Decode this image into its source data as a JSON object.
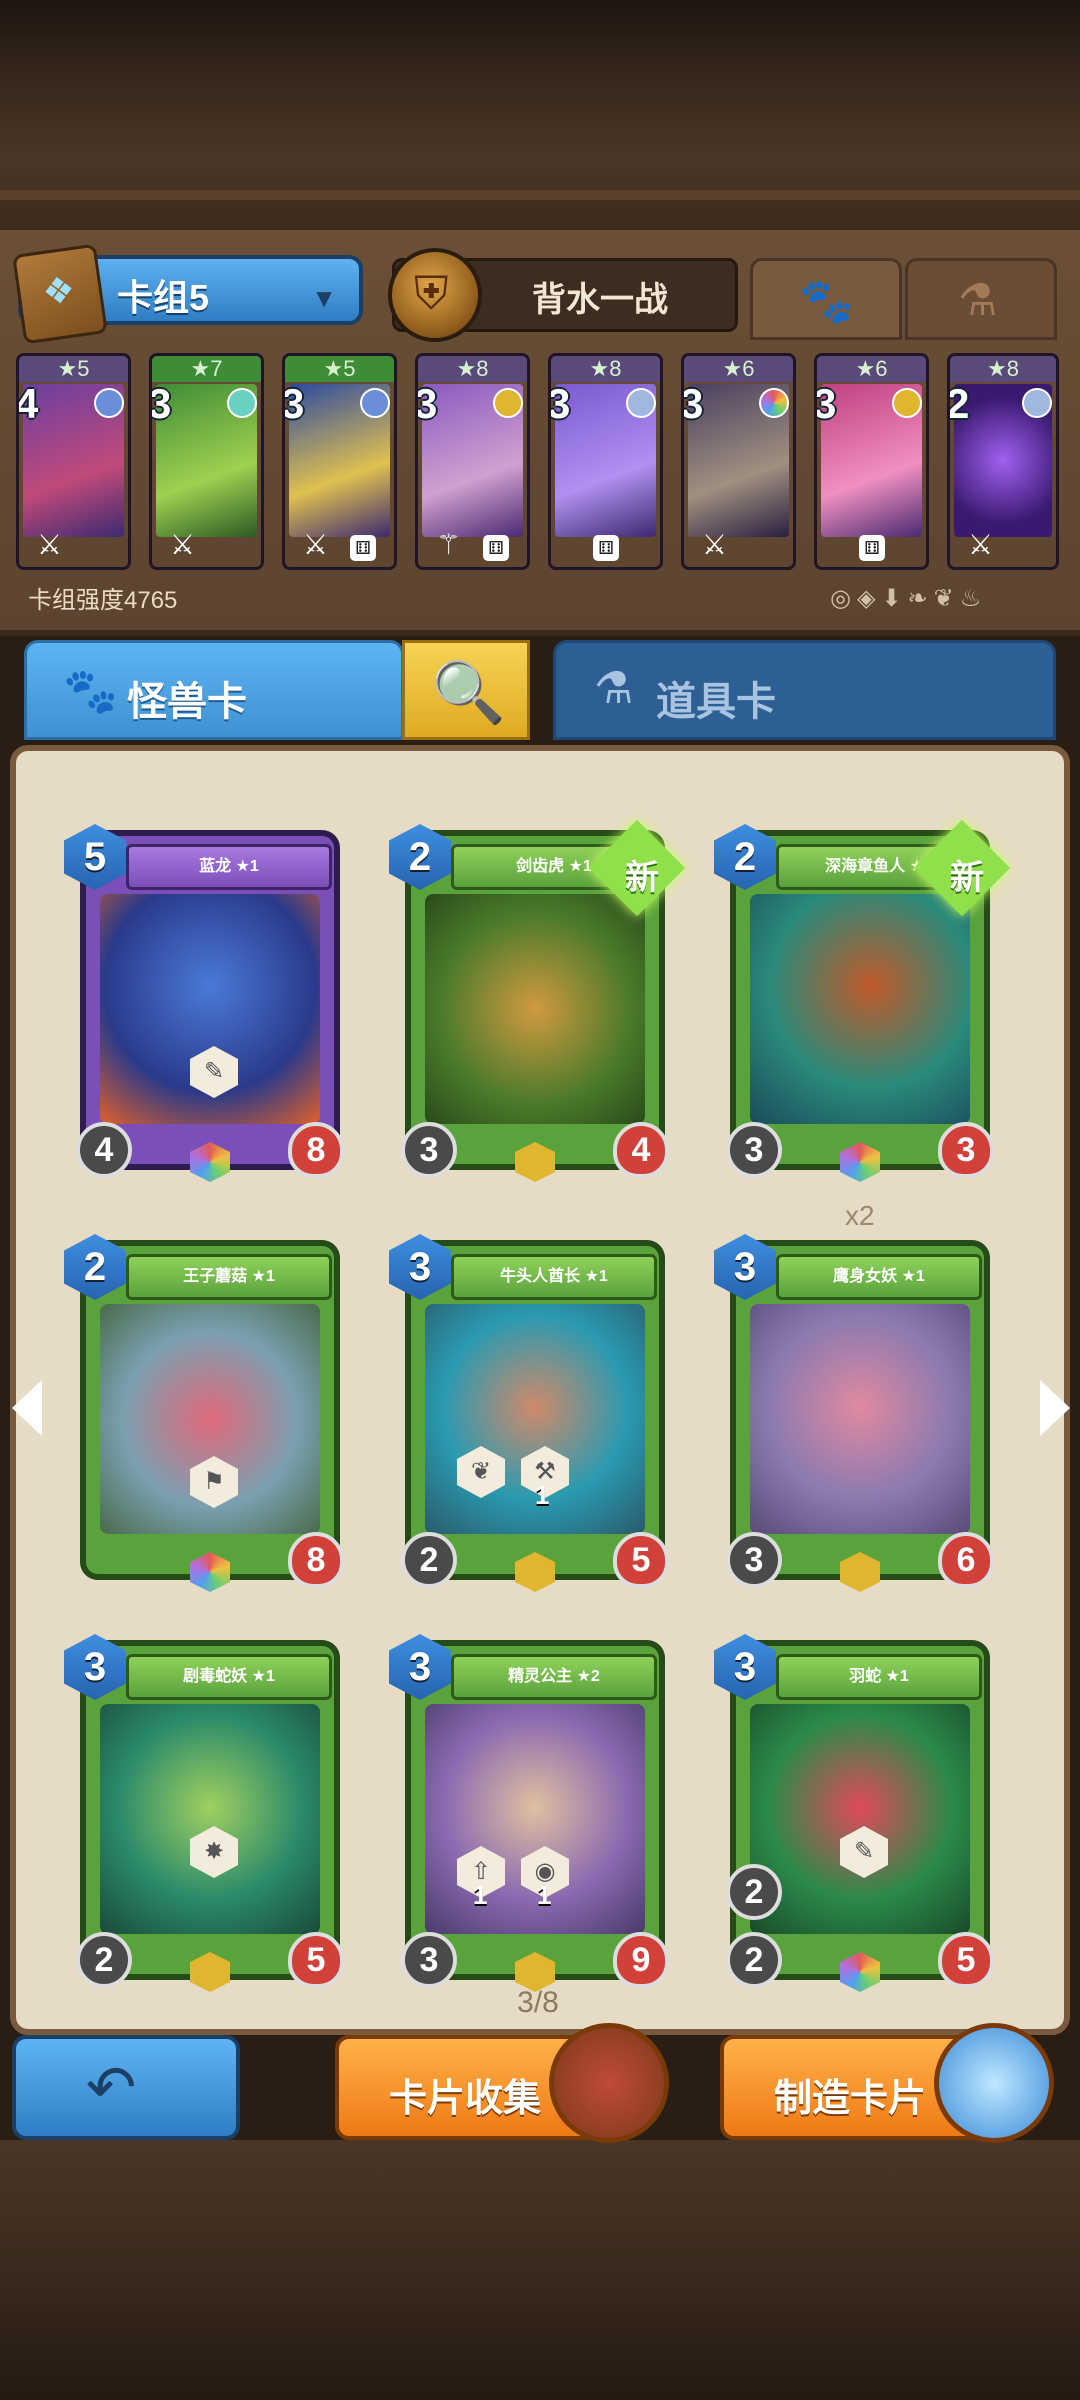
{
  "deck": {
    "selector_label": "卡组5",
    "hero_name": "背水一战",
    "power_label": "卡组强度4765",
    "cards": [
      {
        "cost": "4",
        "stars": "★5"
      },
      {
        "cost": "3",
        "stars": "★7"
      },
      {
        "cost": "3",
        "stars": "★5"
      },
      {
        "cost": "3",
        "stars": "★8"
      },
      {
        "cost": "3",
        "stars": "★8"
      },
      {
        "cost": "3",
        "stars": "★6"
      },
      {
        "cost": "3",
        "stars": "★6"
      },
      {
        "cost": "2",
        "stars": "★8"
      }
    ]
  },
  "categories": {
    "monster_label": "怪兽卡",
    "item_label": "道具卡"
  },
  "cards": [
    {
      "name": "蓝龙 ★1",
      "cost": "5",
      "attack": "4",
      "hp": "8",
      "is_new": false
    },
    {
      "name": "剑齿虎 ★1",
      "cost": "2",
      "attack": "3",
      "hp": "4",
      "is_new": true
    },
    {
      "name": "深海章鱼人 ★1",
      "cost": "2",
      "attack": "3",
      "hp": "3",
      "is_new": true
    },
    {
      "name": "王子蘑菇 ★1",
      "cost": "2",
      "attack": "",
      "hp": "8",
      "is_new": false
    },
    {
      "name": "牛头人酋长 ★1",
      "cost": "3",
      "attack": "2",
      "hp": "5",
      "is_new": false,
      "skill_levels": [
        "1"
      ]
    },
    {
      "name": "鹰身女妖 ★1",
      "cost": "3",
      "attack": "3",
      "hp": "6",
      "is_new": false
    },
    {
      "name": "剧毒蛇妖 ★1",
      "cost": "3",
      "attack": "2",
      "hp": "5",
      "is_new": false
    },
    {
      "name": "精灵公主 ★2",
      "cost": "3",
      "attack": "3",
      "hp": "9",
      "is_new": false,
      "skill_levels": [
        "1",
        "1"
      ]
    },
    {
      "name": "羽蛇 ★1",
      "cost": "3",
      "attack": "2",
      "hp": "5",
      "extra_attack": "2",
      "is_new": false
    }
  ],
  "new_badge": "新",
  "copies_label": "x2",
  "pagination": "3/8",
  "buttons": {
    "collection_label": "卡片收集",
    "craft_label": "制造卡片"
  },
  "colors": {
    "accent_blue": "#3f91d2",
    "orange": "#ef7a14",
    "green_card": "#5aa23c",
    "purple_card": "#7a4fb8",
    "hp_red": "#d2403a"
  }
}
